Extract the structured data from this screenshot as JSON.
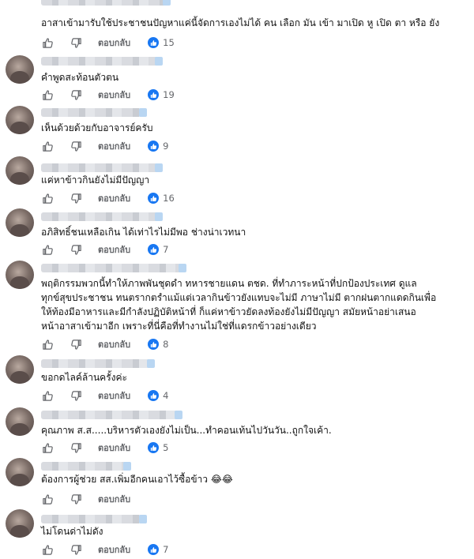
{
  "actions": {
    "reply_label": "ตอบกลับ"
  },
  "comments": [
    {
      "text": "อาสาเข้ามารับใช้ประชาชนปัญหาแค่นี้จัดการเองไม่ได้ คน เลือก มัน เข้า มาเปิด หู เปิด ตา หรือ ยัง",
      "likes": "15"
    },
    {
      "text": "คำพูดสะท้อนตัวตน",
      "likes": "19"
    },
    {
      "text": "เห็นด้วยด้วยกับอาจารย์ครับ",
      "likes": "9"
    },
    {
      "text": "แค่หาข้าวกินยังไม่มีปัญญา",
      "likes": "16"
    },
    {
      "text": "อภิสิทธิ์ชนเหลือเกิน ได้เท่าไรไม่มีพอ ช่างน่าเวทนา",
      "likes": "7"
    },
    {
      "text": "พฤติกรรมพวกนี้ทำให้ภาพพันชุดดำ ทหารชายแดน ตชด. ที่ทำภาระหน้าที่ปกป้องประเทศ ดูแล\nทุกข์สุขประชาชน ทนตรากตรำแม้แต่เวลากินข้าวยังแทบจะไม่มี ภาษาไม่มี ตากฝนตากแดดกินเพื่อ\nให้ท้องมีอาหารและมีกำลังปฏิบัติหน้าที่ ก็แค่หาข้าวยัดลงท้องยังไม่มีปัญญา สมัยหน้าอย่าเสนอ\nหน้าอาสาเข้ามาอีก เพราะที่นี่คือที่ทำงานไม่ใช่ที่แดรกข้าวอย่างเดียว",
      "likes": "8"
    },
    {
      "text": "ขอกดไลค์ล้านครั้งค่ะ",
      "likes": "4"
    },
    {
      "text": "คุณภาพ ส.ส.....บริหารตัวเองยังไม่เป็น...ทำคอนเท้นไปวันวัน..ถูกใจเค้า.",
      "likes": "5"
    },
    {
      "text": "ต้องการผู้ช่วย สส.เพิ่มอีกคนเอาไว้ซื้อข้าว 😂😂",
      "likes": ""
    },
    {
      "text": "ไม่โดนด่าไม่ดัง",
      "likes": "7"
    }
  ]
}
